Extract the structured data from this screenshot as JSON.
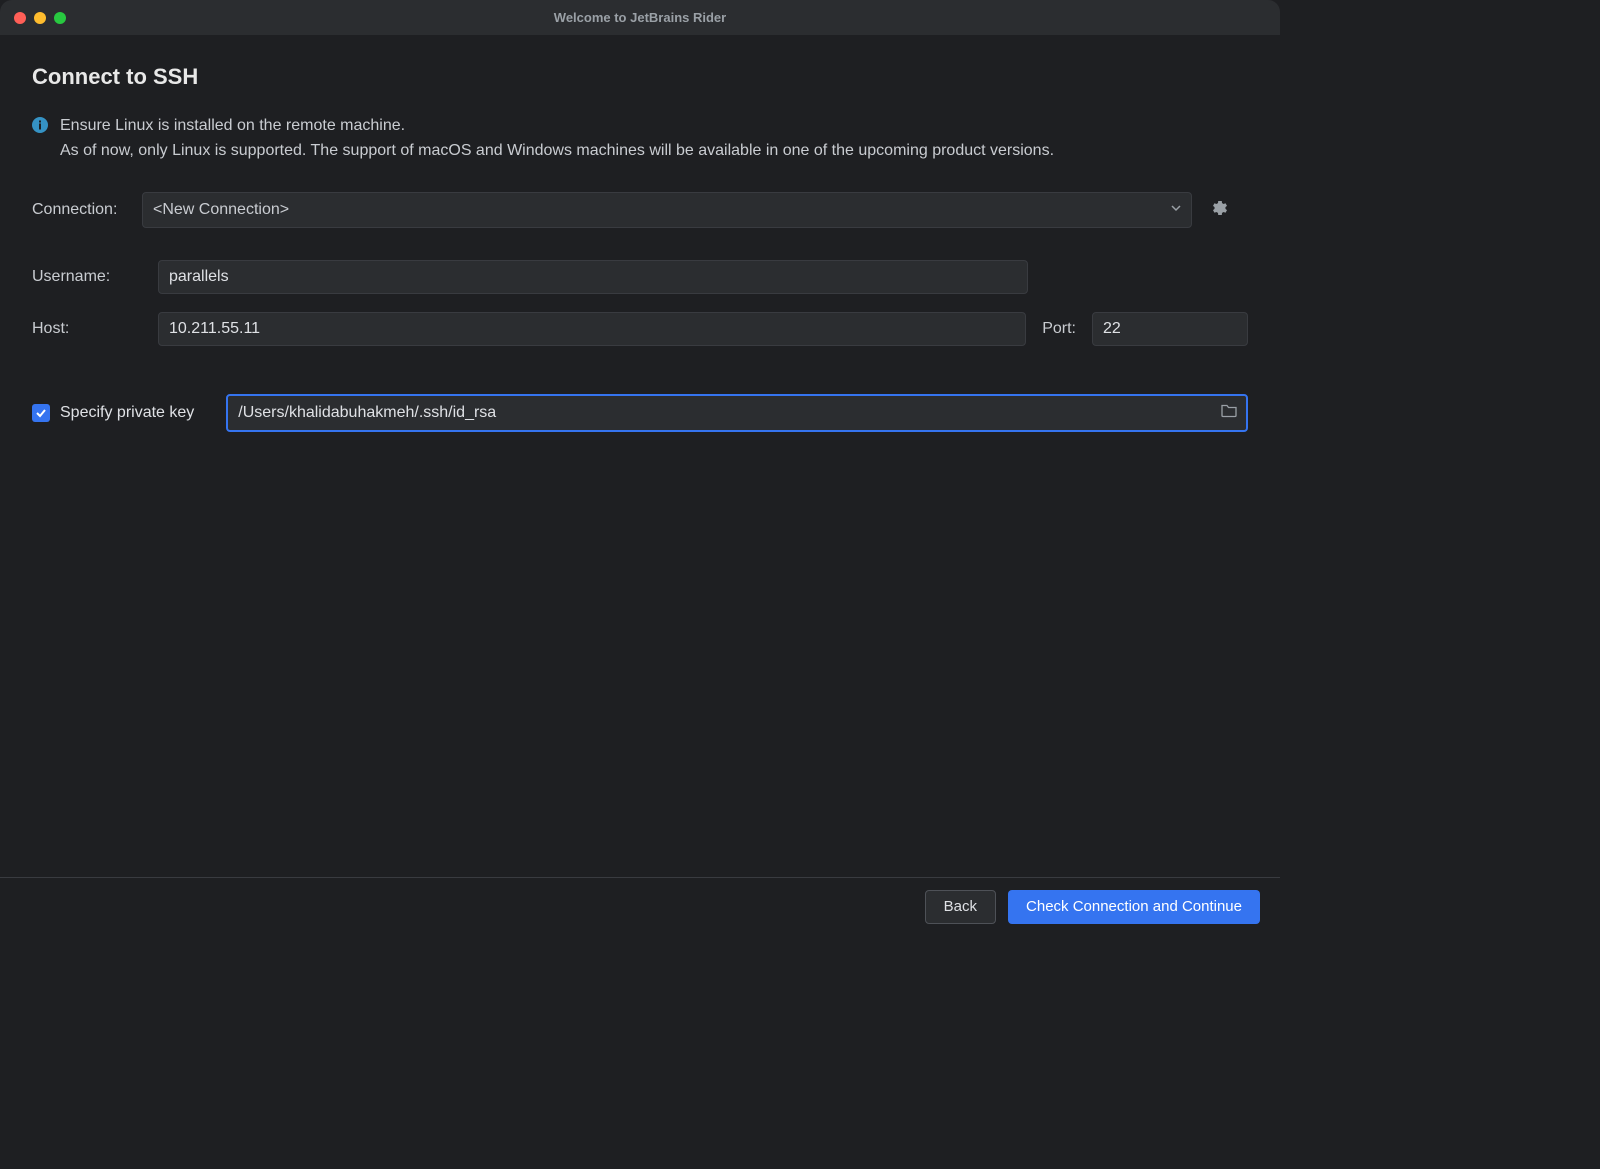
{
  "window": {
    "title": "Welcome to JetBrains Rider"
  },
  "page": {
    "title": "Connect to SSH",
    "info_text_line1": "Ensure Linux is installed on the remote machine.",
    "info_text_line2": "As of now, only Linux is supported. The support of macOS and Windows machines will be available in one of the upcoming product versions."
  },
  "form": {
    "connection_label": "Connection:",
    "connection_value": "<New Connection>",
    "username_label": "Username:",
    "username_value": "parallels",
    "host_label": "Host:",
    "host_value": "10.211.55.11",
    "port_label": "Port:",
    "port_value": "22",
    "private_key_checkbox_label": "Specify private key",
    "private_key_checked": true,
    "private_key_path": "/Users/khalidabuhakmeh/.ssh/id_rsa"
  },
  "footer": {
    "back_label": "Back",
    "continue_label": "Check Connection and Continue"
  },
  "colors": {
    "accent": "#3574f0",
    "bg": "#1e1f22",
    "panel": "#2b2d30",
    "border": "#393b40"
  }
}
